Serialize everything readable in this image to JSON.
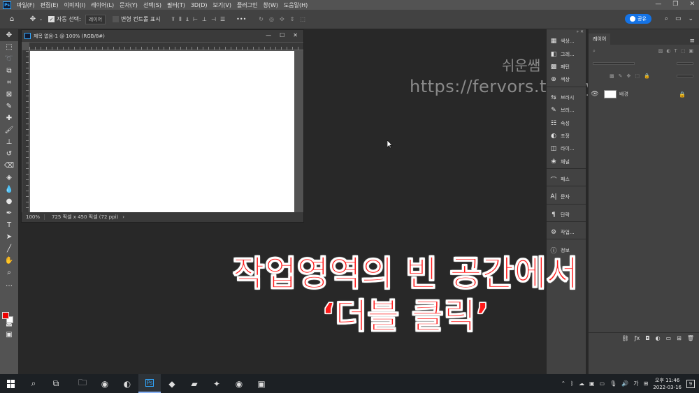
{
  "menubar": {
    "logo": "Ps",
    "items": [
      "파일(F)",
      "편집(E)",
      "이미지(I)",
      "레이어(L)",
      "문자(Y)",
      "선택(S)",
      "필터(T)",
      "3D(D)",
      "보기(V)",
      "플러그인",
      "창(W)",
      "도움말(H)"
    ]
  },
  "optbar": {
    "auto_select_label": "자동 선택:",
    "auto_select_value": "레이어",
    "transform_controls_label": "변형 컨트롤 표시",
    "more": "•••",
    "share_label": "공유"
  },
  "document": {
    "title": "제목 없음-1 @ 100% (RGB/8#)",
    "zoom": "100%",
    "info": "725 픽셀 x 450 픽셀 (72 ppi)",
    "arrow": "›"
  },
  "panels": {
    "group1": [
      "색상...",
      "그레...",
      "패턴",
      "색상"
    ],
    "group2": [
      "브러시",
      "브러...",
      "속성",
      "조정",
      "라이...",
      "채널"
    ],
    "group3": [
      "패스"
    ],
    "group4": [
      "문자"
    ],
    "group5": [
      "단락"
    ],
    "group6": [
      "작업..."
    ],
    "group7": [
      "정보"
    ]
  },
  "layers": {
    "tab": "레이어",
    "layer_name": "배경"
  },
  "watermark": {
    "line1": "쉬운쌤",
    "line2": "https://fervors.tistory.com"
  },
  "caption": {
    "line1": "작업영역의 빈 공간에서",
    "line2": "‘더블 클릭’"
  },
  "taskbar": {
    "time": "오후 11:46",
    "date": "2022-03-16",
    "ime": "가",
    "notification_count": "9"
  },
  "colors": {
    "foreground": "#ee0000",
    "background": "#ffffff",
    "accent": "#1473e6",
    "caption": "#ff1a1a"
  }
}
